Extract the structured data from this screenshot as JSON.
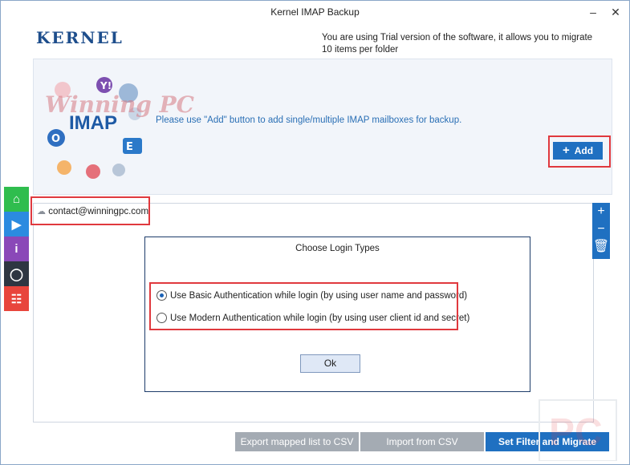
{
  "window": {
    "title": "Kernel IMAP Backup"
  },
  "header": {
    "logo": "KERNEL",
    "trial_notice": "You are using Trial version of the software, it allows you to migrate 10 items per folder"
  },
  "banner": {
    "imap_label": "IMAP",
    "hint": "Please use \"Add\" button to add single/multiple IMAP mailboxes for backup.",
    "add_label": "Add",
    "watermark": "Winning PC"
  },
  "sidebar": [
    "home-icon",
    "video-icon",
    "info-icon",
    "support-icon",
    "cart-icon"
  ],
  "mailboxes": [
    {
      "email": "contact@winningpc.com"
    }
  ],
  "dialog": {
    "title": "Choose Login Types",
    "option_basic": "Use Basic Authentication while login (by using user name and password)",
    "option_modern": "Use Modern Authentication while login (by using user client id and secret)",
    "selected": "basic",
    "ok_label": "Ok"
  },
  "footer": {
    "export_label": "Export mapped list to CSV",
    "import_label": "Import from CSV",
    "migrate_label": "Set Filter and Migrate"
  },
  "colors": {
    "accent": "#1f70c1",
    "highlight": "#e0393e",
    "home": "#2fbd4e",
    "video": "#2b8be0",
    "info": "#8a48b8",
    "support": "#2e3642",
    "cart": "#e8453c"
  },
  "corner_watermark": "PC"
}
